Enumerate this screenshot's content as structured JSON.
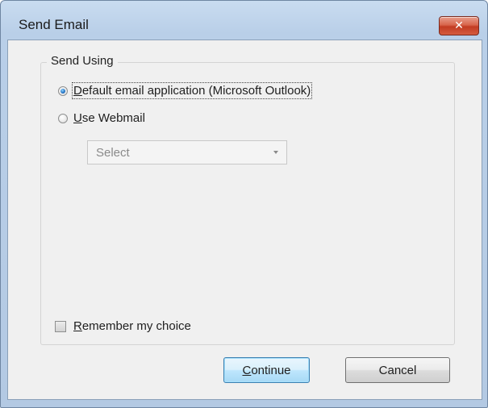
{
  "window": {
    "title": "Send Email",
    "close_glyph": "✕"
  },
  "group": {
    "label": "Send Using"
  },
  "options": {
    "default_app": {
      "first_letter": "D",
      "rest": "efault email application (Microsoft Outlook)",
      "checked": true
    },
    "webmail": {
      "first_letter": "U",
      "rest": "se Webmail",
      "checked": false
    }
  },
  "webmail_select": {
    "value": "Select"
  },
  "remember": {
    "first_letter": "R",
    "rest": "emember my choice",
    "checked": false
  },
  "buttons": {
    "continue_first_letter": "C",
    "continue_rest": "ontinue",
    "cancel": "Cancel"
  },
  "colors": {
    "title_bar": "#b9cfe8",
    "close_button": "#c23b22",
    "client_bg": "#f0f0f0",
    "default_button_border": "#3c7fb1"
  },
  "icons": [
    "close-icon",
    "chevron-down-icon"
  ]
}
